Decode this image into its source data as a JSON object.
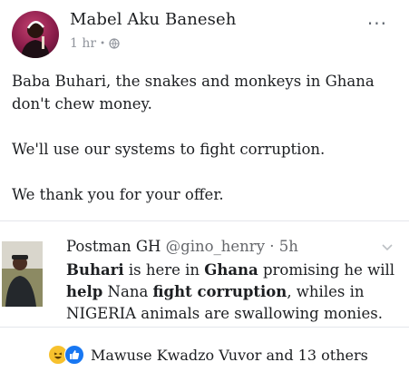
{
  "post": {
    "author": "Mabel Aku Baneseh",
    "time": "1 hr",
    "separator": "•",
    "more_label": "...",
    "paragraphs": [
      "Baba Buhari, the snakes and monkeys in Ghana don't chew money.",
      "We'll use our systems to fight corruption.",
      "We thank you for your offer."
    ]
  },
  "shared": {
    "name": "Postman GH",
    "handle": "@gino_henry",
    "separator": "·",
    "time": "5h",
    "text_parts": [
      {
        "t": "Buhari",
        "bold": true
      },
      {
        "t": " is here in ",
        "bold": false
      },
      {
        "t": "Ghana",
        "bold": true
      },
      {
        "t": " promising he will ",
        "bold": false
      },
      {
        "t": "help",
        "bold": true
      },
      {
        "t": " Nana ",
        "bold": false
      },
      {
        "t": "fight corruption",
        "bold": true
      },
      {
        "t": ", whiles in NIGERIA animals are swallowing monies.",
        "bold": false
      }
    ]
  },
  "reactions": {
    "icons": [
      "haha-icon",
      "like-icon"
    ],
    "text": "Mawuse Kwadzo Vuvor and 13 others"
  },
  "colors": {
    "secondary_text": "#90949c",
    "like_blue": "#1877f2",
    "haha_yellow": "#f7c12d",
    "divider": "#e4e6eb"
  }
}
